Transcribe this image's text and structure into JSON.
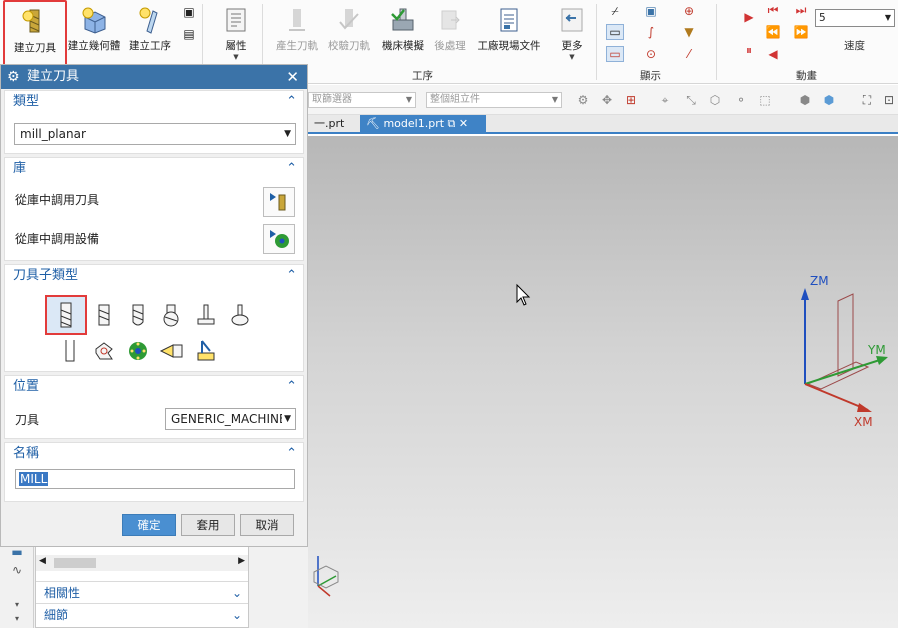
{
  "ribbon": {
    "buttons": [
      {
        "label": "建立刀具"
      },
      {
        "label": "建立幾何體"
      },
      {
        "label": "建立工序"
      },
      {
        "label": "屬性"
      },
      {
        "label": "產生刀軌"
      },
      {
        "label": "校驗刀軌"
      },
      {
        "label": "機床模擬"
      },
      {
        "label": "後處理"
      },
      {
        "label": "工廠現場文件"
      },
      {
        "label": "更多"
      }
    ],
    "groups": {
      "operation": "工序",
      "display": "顯示",
      "animation": "動畫"
    },
    "speed": {
      "value": "5",
      "label": "速度"
    }
  },
  "filterbar": {
    "selection_filter": "取篩選器",
    "scope": "整個組立件"
  },
  "file_tabs": [
    {
      "label": "一.prt"
    },
    {
      "label": "model1.prt"
    }
  ],
  "dialog": {
    "title": "建立刀具",
    "type_section": {
      "title": "類型",
      "value": "mill_planar"
    },
    "library_section": {
      "title": "庫",
      "retrieve_tool": "從庫中調用刀具",
      "retrieve_device": "從庫中調用設備"
    },
    "subtype_section": {
      "title": "刀具子類型"
    },
    "location_section": {
      "title": "位置",
      "tool_label": "刀具",
      "tool_value": "GENERIC_MACHINE"
    },
    "name_section": {
      "title": "名稱",
      "value": "MILL"
    },
    "buttons": {
      "ok": "確定",
      "apply": "套用",
      "cancel": "取消"
    }
  },
  "nav_panel": {
    "sections": [
      {
        "label": "相關性"
      },
      {
        "label": "細節"
      }
    ]
  },
  "triad": {
    "x": "XM",
    "y": "YM",
    "z": "ZM"
  },
  "colors": {
    "dialog_title": "#3b73a8",
    "section_heading": "#1f5fa6",
    "highlight_red": "#e23b3b",
    "active_tab": "#3f83c6",
    "x_axis": "#c0392b",
    "y_axis": "#2e9a35",
    "z_axis": "#1f4fbf"
  }
}
